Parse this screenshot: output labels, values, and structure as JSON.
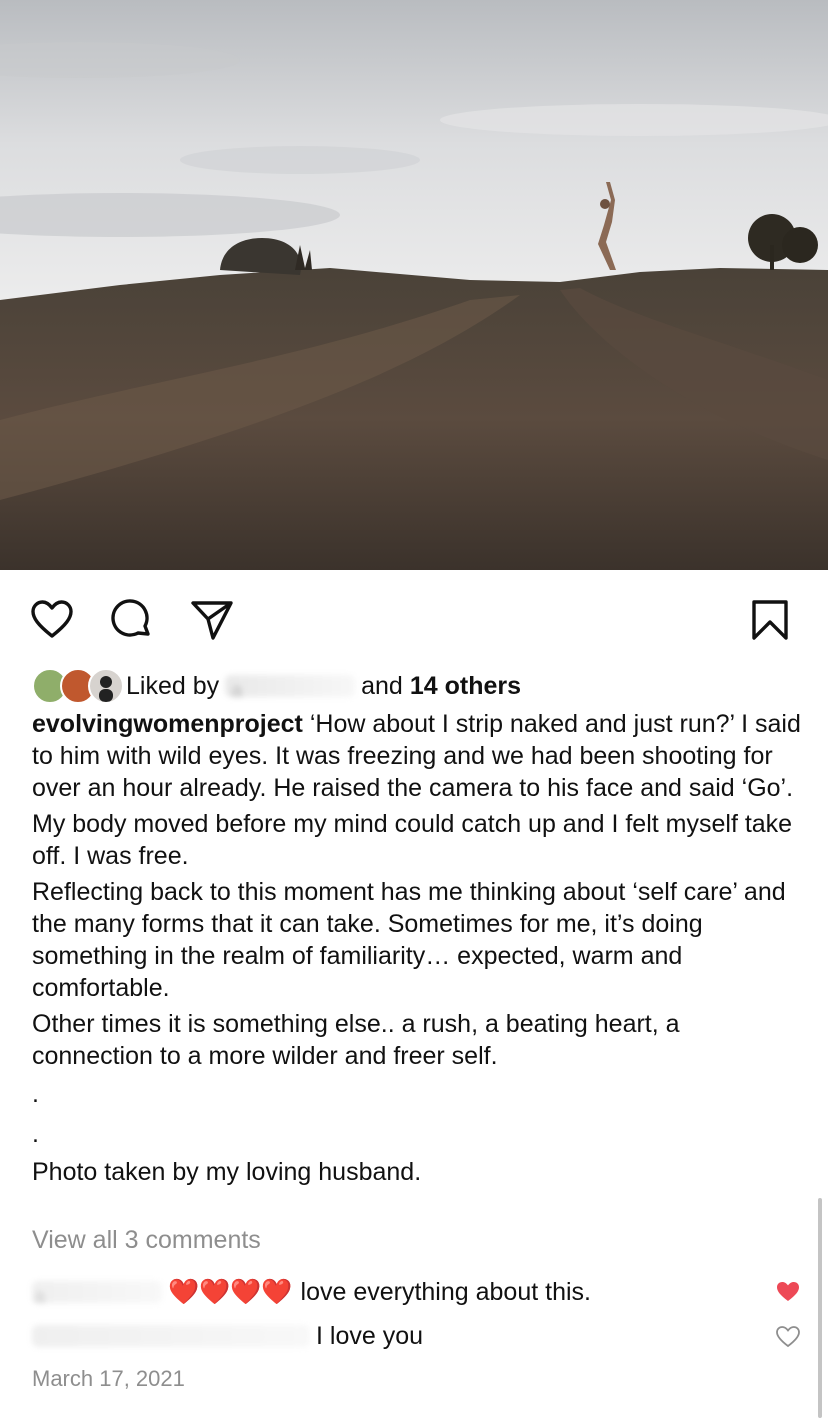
{
  "post": {
    "image_alt": "Woman leaping on a hilltop under a cloudy sky",
    "liked_by_prefix": "Liked by",
    "liked_by_user": "a",
    "likes_connector": "and",
    "likes_others": "14 others"
  },
  "caption": {
    "username": "evolvingwomenproject",
    "paragraphs": [
      "‘How about I strip naked and just run?’ I said to him with wild eyes. It was freezing and we had been shooting for over an hour already. He raised the camera to his face and said ‘Go’.",
      "My body moved before my mind could catch up and I felt myself take off. I was free.",
      "Reflecting back to this moment has me thinking about ‘self care’ and the many forms that it can take. Sometimes for me, it’s doing something in the realm of familiarity… expected, warm and comfortable.",
      "Other times it is something else.. a rush, a beating heart, a connection to a more wilder and freer self.",
      ".",
      ".",
      "Photo taken by my loving husband."
    ]
  },
  "comments": {
    "view_all": "View all 3 comments",
    "items": [
      {
        "user": "a",
        "hearts": "❤️❤️❤️❤️",
        "text": "love everything about this.",
        "liked": true
      },
      {
        "user": "",
        "hearts": "",
        "text": "I love you",
        "liked": false
      }
    ]
  },
  "date": "March 17, 2021",
  "icons": {
    "like": "heart-icon",
    "comment": "comment-icon",
    "share": "send-icon",
    "save": "bookmark-icon"
  },
  "colors": {
    "like_red": "#ed4956",
    "muted": "#8e8e8e"
  }
}
